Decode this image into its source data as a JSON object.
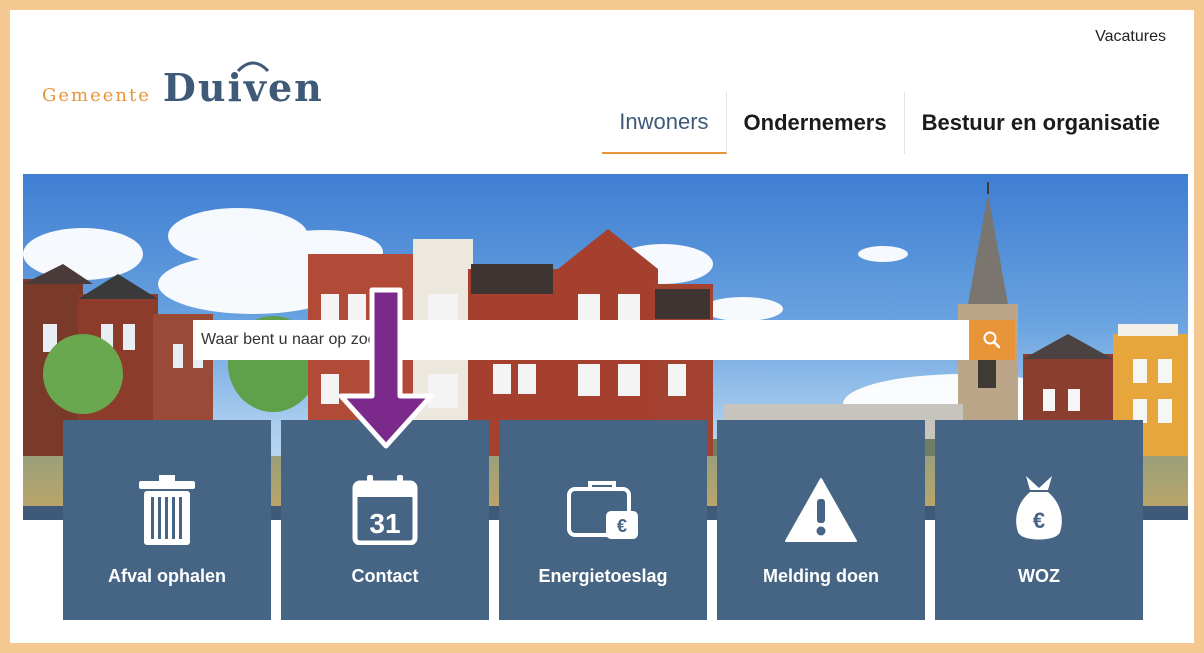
{
  "header": {
    "top_link": "Vacatures",
    "logo": {
      "prefix": "Gemeente",
      "name": "Duiven"
    }
  },
  "nav": {
    "items": [
      {
        "label": "Inwoners",
        "active": true
      },
      {
        "label": "Ondernemers",
        "active": false
      },
      {
        "label": "Bestuur en organisatie",
        "active": false
      }
    ]
  },
  "search": {
    "placeholder": "Waar bent u naar op zoek?"
  },
  "tiles": [
    {
      "label": "Afval ophalen",
      "icon": "trash-icon"
    },
    {
      "label": "Contact",
      "icon": "calendar-icon",
      "icon_text": "31"
    },
    {
      "label": "Energietoeslag",
      "icon": "wallet-euro-icon",
      "icon_text": "€"
    },
    {
      "label": "Melding doen",
      "icon": "warning-icon"
    },
    {
      "label": "WOZ",
      "icon": "money-bag-icon",
      "icon_text": "€"
    }
  ],
  "colors": {
    "frame": "#f6c891",
    "accent": "#e8953a",
    "brand": "#3e5a78",
    "tile": "#466584",
    "annotation_arrow": "#7b2a8c"
  }
}
